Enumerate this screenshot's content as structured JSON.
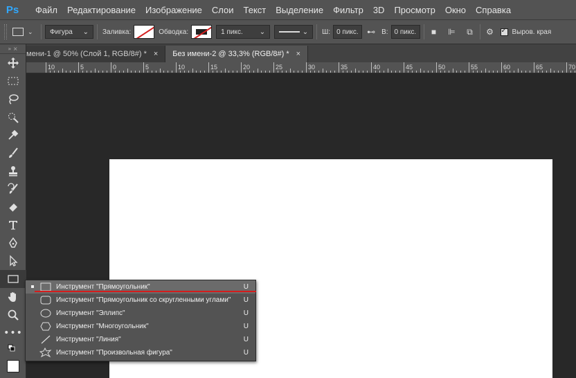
{
  "app": {
    "logo": "Ps"
  },
  "menu": [
    "Файл",
    "Редактирование",
    "Изображение",
    "Слои",
    "Текст",
    "Выделение",
    "Фильтр",
    "3D",
    "Просмотр",
    "Окно",
    "Справка"
  ],
  "options": {
    "mode_value": "Фигура",
    "fill_label": "Заливка:",
    "stroke_label": "Обводка:",
    "stroke_width": "1 пикс.",
    "width_label": "Ш:",
    "width_value": "0 пикс.",
    "link_icon": "link-icon",
    "height_label": "В:",
    "height_value": "0 пикс.",
    "align_edges_label": "Выров. края",
    "colors": {
      "fill": "#ffffff",
      "slash": "#d42020"
    }
  },
  "tabs": [
    {
      "label": "мени-1 @ 50% (Слой 1, RGB/8#) *",
      "close": "×"
    },
    {
      "label": "Без имени-2 @ 33,3% (RGB/8#) *",
      "close": "×"
    }
  ],
  "ruler": {
    "labels": [
      "10",
      "5",
      "0",
      "5",
      "10",
      "15",
      "20",
      "25",
      "30",
      "35",
      "40",
      "45",
      "50",
      "55",
      "60",
      "65",
      "70"
    ]
  },
  "flyout": {
    "items": [
      {
        "label": "Инструмент \"Прямоугольник\"",
        "key": "U",
        "icon": "rectangle-icon"
      },
      {
        "label": "Инструмент \"Прямоугольник со скругленными углами\"",
        "key": "U",
        "icon": "rounded-rectangle-icon"
      },
      {
        "label": "Инструмент \"Эллипс\"",
        "key": "U",
        "icon": "ellipse-icon"
      },
      {
        "label": "Инструмент \"Многоугольник\"",
        "key": "U",
        "icon": "polygon-icon"
      },
      {
        "label": "Инструмент \"Линия\"",
        "key": "U",
        "icon": "line-icon"
      },
      {
        "label": "Инструмент \"Произвольная фигура\"",
        "key": "U",
        "icon": "custom-shape-icon"
      }
    ]
  },
  "annotation_color": "#d41c1c"
}
